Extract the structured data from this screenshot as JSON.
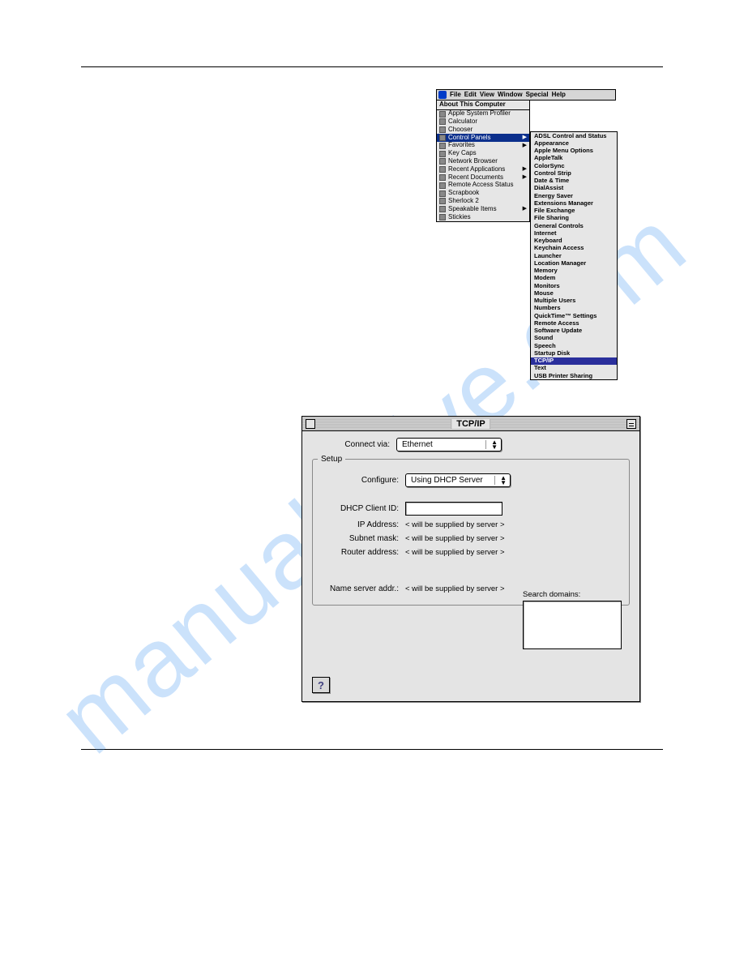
{
  "watermark": "manualshive.com",
  "menubar": {
    "items": [
      "File",
      "Edit",
      "View",
      "Window",
      "Special",
      "Help"
    ]
  },
  "appleMenu": {
    "header": "About This Computer",
    "items": [
      {
        "ico": true,
        "label": "Apple System Profiler"
      },
      {
        "ico": true,
        "label": "Calculator"
      },
      {
        "ico": true,
        "label": "Chooser"
      },
      {
        "ico": true,
        "label": "Control Panels",
        "sub": true,
        "selected": true
      },
      {
        "ico": true,
        "label": "Favorites",
        "sub": true
      },
      {
        "ico": true,
        "label": "Key Caps"
      },
      {
        "ico": true,
        "label": "Network Browser"
      },
      {
        "ico": true,
        "label": "Recent Applications",
        "sub": true
      },
      {
        "ico": true,
        "label": "Recent Documents",
        "sub": true
      },
      {
        "ico": true,
        "label": "Remote Access Status"
      },
      {
        "ico": true,
        "label": "Scrapbook"
      },
      {
        "ico": true,
        "label": "Sherlock 2"
      },
      {
        "ico": true,
        "label": "Speakable Items",
        "sub": true
      },
      {
        "ico": true,
        "label": "Stickies"
      }
    ]
  },
  "controlPanels": [
    "ADSL Control and Status",
    "Appearance",
    "Apple Menu Options",
    "AppleTalk",
    "ColorSync",
    "Control Strip",
    "Date & Time",
    "DialAssist",
    "Energy Saver",
    "Extensions Manager",
    "File Exchange",
    "File Sharing",
    "General Controls",
    "Internet",
    "Keyboard",
    "Keychain Access",
    "Launcher",
    "Location Manager",
    "Memory",
    "Modem",
    "Monitors",
    "Mouse",
    "Multiple Users",
    "Numbers",
    "QuickTime™ Settings",
    "Remote Access",
    "Software Update",
    "Sound",
    "Speech",
    "Startup Disk",
    "TCP/IP",
    "Text",
    "USB Printer Sharing"
  ],
  "controlPanelsHighlight": "TCP/IP",
  "tcpip": {
    "title": "TCP/IP",
    "connectVia": {
      "label": "Connect via:",
      "value": "Ethernet"
    },
    "setupLegend": "Setup",
    "configure": {
      "label": "Configure:",
      "value": "Using DHCP Server"
    },
    "dhcpClientId": {
      "label": "DHCP Client ID:",
      "value": ""
    },
    "ipAddress": {
      "label": "IP Address:",
      "value": "< will be supplied by server >"
    },
    "subnet": {
      "label": "Subnet mask:",
      "value": "< will be supplied by server >"
    },
    "router": {
      "label": "Router address:",
      "value": "< will be supplied by server >"
    },
    "nameServer": {
      "label": "Name server addr.:",
      "value": "< will be supplied by server >"
    },
    "searchDomains": {
      "label": "Search domains:"
    },
    "help": "?"
  }
}
